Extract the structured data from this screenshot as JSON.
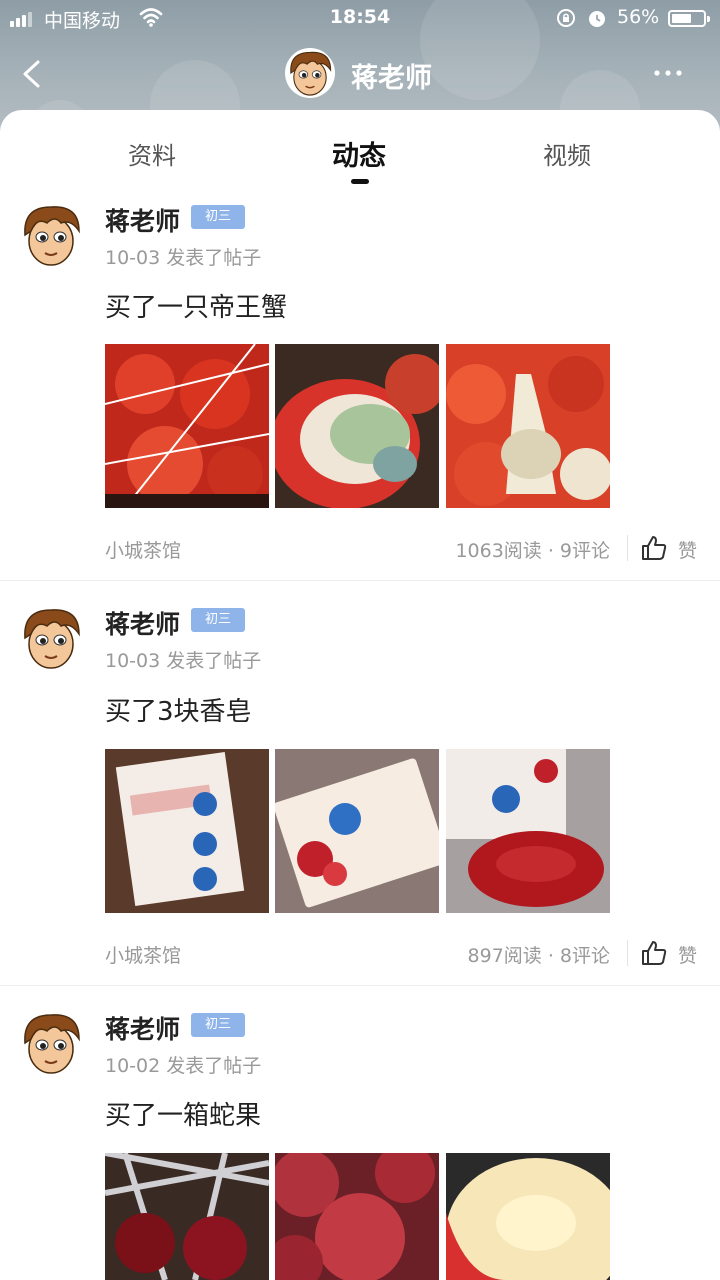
{
  "status_bar": {
    "carrier": "中国移动",
    "time": "18:54",
    "battery": "56%"
  },
  "nav": {
    "title": "蒋老师",
    "back_icon": "chevron-left-icon",
    "more_icon": "more-horizontal-icon"
  },
  "tabs": [
    {
      "label": "资料",
      "active": false
    },
    {
      "label": "动态",
      "active": true
    },
    {
      "label": "视频",
      "active": false
    }
  ],
  "posts": [
    {
      "author": "蒋老师",
      "badge": "初三",
      "meta": "10-03 发表了帖子",
      "text": "买了一只帝王蟹",
      "forum": "小城茶馆",
      "stats": "1063阅读 · 9评论",
      "like_label": "赞",
      "image_theme": "crab"
    },
    {
      "author": "蒋老师",
      "badge": "初三",
      "meta": "10-03 发表了帖子",
      "text": "买了3块香皂",
      "forum": "小城茶馆",
      "stats": "897阅读 · 8评论",
      "like_label": "赞",
      "image_theme": "soap"
    },
    {
      "author": "蒋老师",
      "badge": "初三",
      "meta": "10-02 发表了帖子",
      "text": "买了一箱蛇果",
      "forum": "",
      "stats": "",
      "like_label": "",
      "image_theme": "apple"
    }
  ],
  "colors": {
    "badge": "#8fb4ea",
    "header": "#9aa7ae"
  }
}
